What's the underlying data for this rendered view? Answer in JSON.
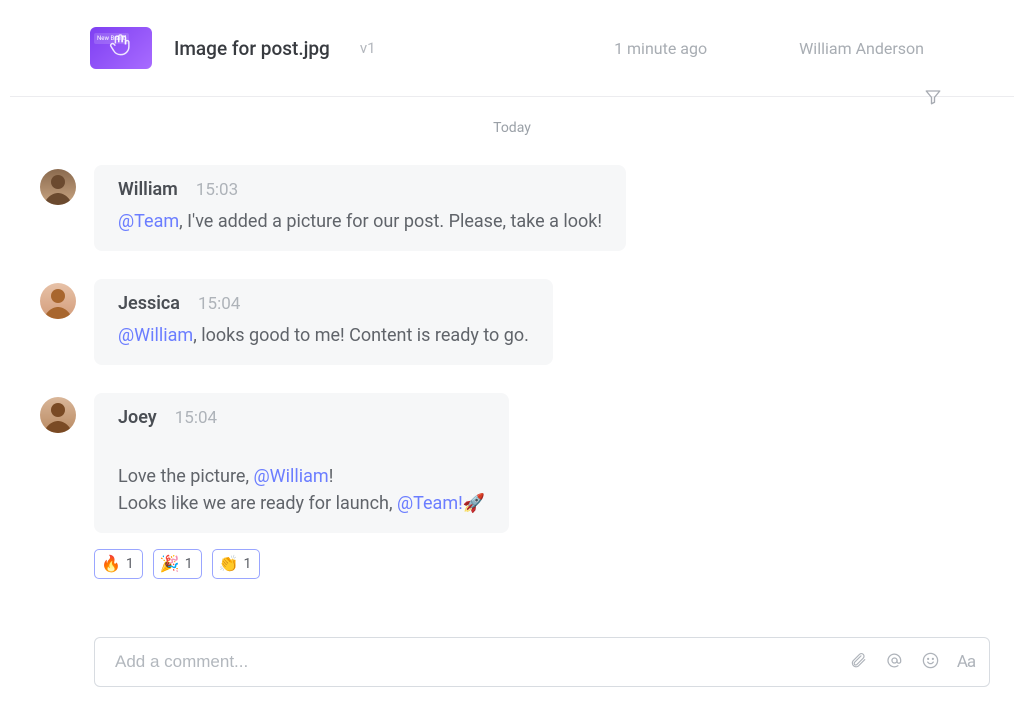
{
  "file": {
    "name": "Image for post.jpg",
    "version": "v1",
    "time_label": "1 minute ago",
    "owner": "William Anderson",
    "thumb_tag": "New Brand",
    "thumb_accent": "#7e3ff2"
  },
  "separator_label": "Today",
  "comments": [
    {
      "author": "William",
      "time": "15:03",
      "body_prefix": "",
      "mention1": "@Team",
      "body_mid": ", I've added a picture for our post. Please, take a look!",
      "mention2": "",
      "body_suffix": "",
      "avatar_bg": "#b59073",
      "reactions": []
    },
    {
      "author": "Jessica",
      "time": "15:04",
      "body_prefix": "",
      "mention1": "@William",
      "body_mid": ", looks good to me! Content is ready to go.",
      "mention2": "",
      "body_suffix": "",
      "avatar_bg": "#d9b29c",
      "reactions": []
    },
    {
      "author": "Joey",
      "time": "15:04",
      "body_prefix": "Love the picture, ",
      "mention1": "@William",
      "body_mid": "!\nLooks like we are ready for launch, ",
      "mention2": "@Team!",
      "body_suffix": "🚀",
      "avatar_bg": "#c9a080",
      "reactions": [
        {
          "emoji": "🔥",
          "count": "1"
        },
        {
          "emoji": "🎉",
          "count": "1"
        },
        {
          "emoji": "👏",
          "count": "1"
        }
      ]
    }
  ],
  "composer": {
    "placeholder": "Add a comment...",
    "format_label": "Aa"
  },
  "icons": {
    "filter": "filter-icon",
    "attach": "paperclip-icon",
    "mention": "at-icon",
    "emoji": "smiley-icon",
    "format": "format-icon"
  }
}
